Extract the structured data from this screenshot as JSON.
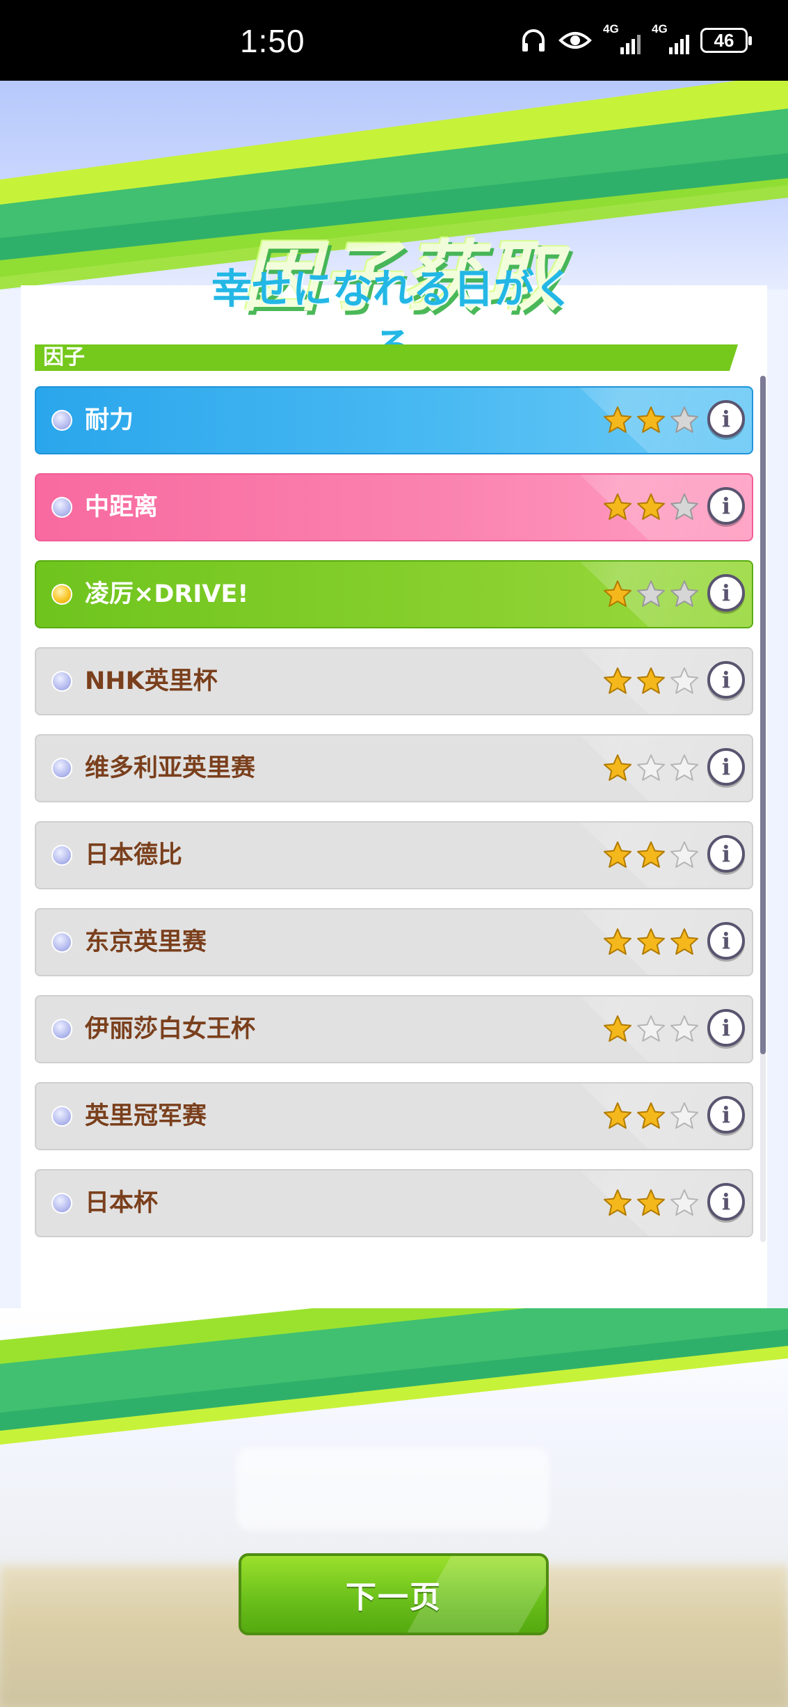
{
  "status_bar": {
    "time": "1:50",
    "network_1": "4G",
    "network_2": "4G",
    "battery": "46",
    "icons": [
      "headphones-icon",
      "eye-icon",
      "signal-icon",
      "signal-icon",
      "battery-icon"
    ]
  },
  "title": {
    "main": "因子获取",
    "subtitle": "幸せになれる日がくる"
  },
  "section": {
    "header": "因子"
  },
  "factors": [
    {
      "label": "耐力",
      "stars": 2,
      "max_stars": 3,
      "color": "blue"
    },
    {
      "label": "中距离",
      "stars": 2,
      "max_stars": 3,
      "color": "pink"
    },
    {
      "label": "凌厉×DRIVE!",
      "stars": 1,
      "max_stars": 3,
      "color": "green"
    },
    {
      "label": "NHK英里杯",
      "stars": 2,
      "max_stars": 3,
      "color": "gray"
    },
    {
      "label": "维多利亚英里赛",
      "stars": 1,
      "max_stars": 3,
      "color": "gray"
    },
    {
      "label": "日本德比",
      "stars": 2,
      "max_stars": 3,
      "color": "gray"
    },
    {
      "label": "东京英里赛",
      "stars": 3,
      "max_stars": 3,
      "color": "gray"
    },
    {
      "label": "伊丽莎白女王杯",
      "stars": 1,
      "max_stars": 3,
      "color": "gray"
    },
    {
      "label": "英里冠军赛",
      "stars": 2,
      "max_stars": 3,
      "color": "gray"
    },
    {
      "label": "日本杯",
      "stars": 2,
      "max_stars": 3,
      "color": "gray"
    }
  ],
  "info_icon_glyph": "i",
  "next_button": {
    "label": "下一页"
  },
  "colors": {
    "accent_green": "#75c81c",
    "blue_row": "#2aa6ec",
    "pink_row": "#f86aa0",
    "green_row": "#6fc41e",
    "gray_row": "#e1e1e1",
    "label_brown": "#7a3f1c",
    "star_gold": "#f5b81c"
  }
}
